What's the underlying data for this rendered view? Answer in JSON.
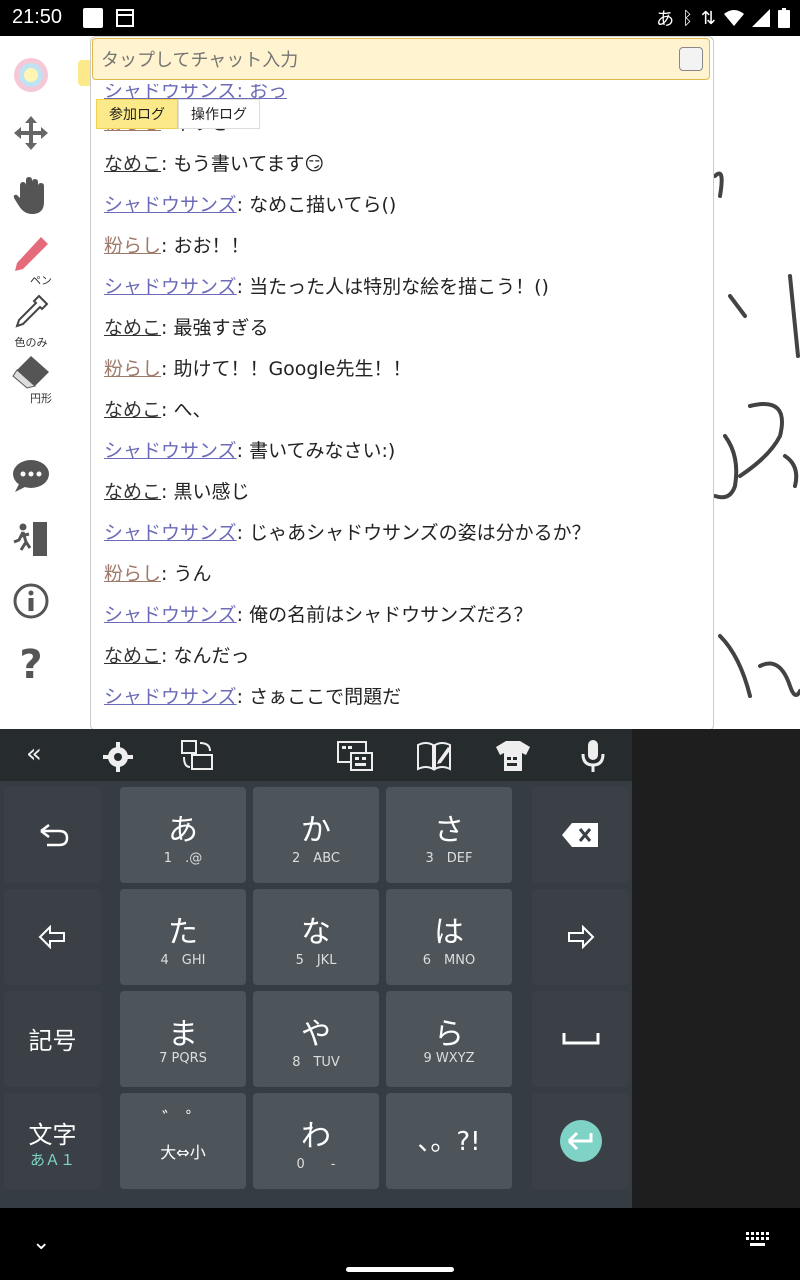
{
  "status_bar": {
    "time": "21:50",
    "ime_indicator": "あ"
  },
  "toolbar": {
    "pen_label": "ペン",
    "dropper_label": "色のみ",
    "eraser_label": "円形"
  },
  "chat": {
    "input_placeholder": "タップしてチャット入力",
    "tabs": [
      "参加ログ",
      "操作ログ"
    ],
    "partial_top": "シャドウサンズ: おっ",
    "messages": [
      {
        "name": "粉らし",
        "text": ": 早すぎ",
        "role": "kona"
      },
      {
        "name": "なめこ",
        "text": ": もう書いてます😏",
        "role": "nameko"
      },
      {
        "name": "シャドウサンズ",
        "text": ": なめこ描いてら()",
        "role": "shadow"
      },
      {
        "name": "粉らし",
        "text": ": おお！！",
        "role": "kona"
      },
      {
        "name": "シャドウサンズ",
        "text": ": 当たった人は特別な絵を描こう！()",
        "role": "shadow"
      },
      {
        "name": "なめこ",
        "text": ": 最強すぎる",
        "role": "nameko"
      },
      {
        "name": "粉らし",
        "text": ": 助けて！！Google先生！！",
        "role": "kona"
      },
      {
        "name": "なめこ",
        "text": ": へ、",
        "role": "nameko"
      },
      {
        "name": "シャドウサンズ",
        "text": ": 書いてみなさい:)",
        "role": "shadow"
      },
      {
        "name": "なめこ",
        "text": ": 黒い感じ",
        "role": "nameko"
      },
      {
        "name": "シャドウサンズ",
        "text": ": じゃあシャドウサンズの姿は分かるか？",
        "role": "shadow"
      },
      {
        "name": "粉らし",
        "text": ": うん",
        "role": "kona"
      },
      {
        "name": "シャドウサンズ",
        "text": ": 俺の名前はシャドウサンズだろ？",
        "role": "shadow"
      },
      {
        "name": "なめこ",
        "text": ": なんだっ",
        "role": "nameko"
      },
      {
        "name": "シャドウサンズ",
        "text": ": さぁここで問題だ",
        "role": "shadow"
      }
    ]
  },
  "keyboard": {
    "keys": [
      {
        "main": "あ",
        "sub": "1　.@"
      },
      {
        "main": "か",
        "sub": "2　ABC"
      },
      {
        "main": "さ",
        "sub": "3　DEF"
      },
      {
        "main": "た",
        "sub": "4　GHI"
      },
      {
        "main": "な",
        "sub": "5　JKL"
      },
      {
        "main": "は",
        "sub": "6　MNO"
      },
      {
        "main": "ま",
        "sub": "7 PQRS"
      },
      {
        "main": "や",
        "sub": "8　TUV"
      },
      {
        "main": "ら",
        "sub": "9 WXYZ"
      },
      {
        "main": "゛ ゜",
        "sub": "大⇔小"
      },
      {
        "main": "わ",
        "sub": "0　　-"
      },
      {
        "main": "、。?!",
        "sub": ""
      }
    ],
    "symbol_key": "記号",
    "mode_key": "文字",
    "mode_sub": "あＡ１"
  },
  "colors": {
    "accent": "#fbe98a",
    "shadow_name": "#6b6bb7",
    "kona_name": "#9e7a6a",
    "enter": "#7ed3c6"
  }
}
